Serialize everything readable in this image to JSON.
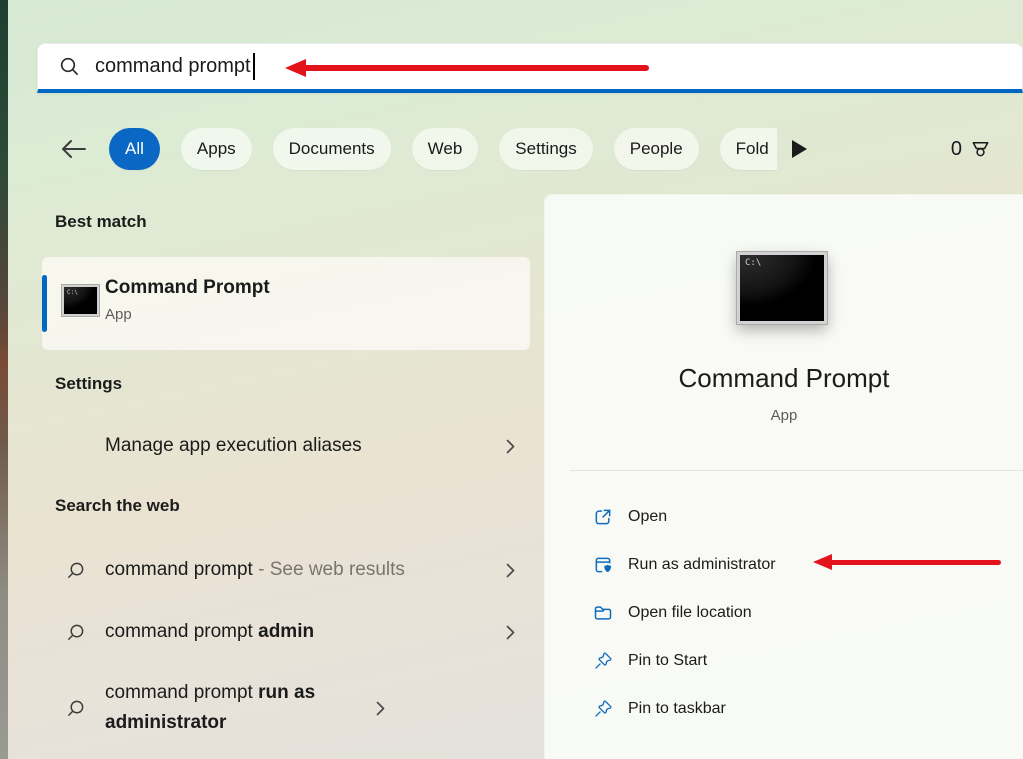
{
  "search": {
    "value": "command prompt"
  },
  "tabs": {
    "items": [
      {
        "label": "All"
      },
      {
        "label": "Apps"
      },
      {
        "label": "Documents"
      },
      {
        "label": "Web"
      },
      {
        "label": "Settings"
      },
      {
        "label": "People"
      },
      {
        "label": "Fold"
      }
    ],
    "selected": "All",
    "rewards_count": "0"
  },
  "best_match": {
    "heading": "Best match",
    "title": "Command Prompt",
    "subtitle": "App",
    "icon_label": "C:\\"
  },
  "settings_section": {
    "heading": "Settings",
    "item": "Manage app execution aliases"
  },
  "web_section": {
    "heading": "Search the web",
    "rows": [
      {
        "query": "command prompt",
        "suffix": "- See web results"
      },
      {
        "query": "command prompt",
        "bold": "admin"
      },
      {
        "query": "command prompt",
        "bold": "run as administrator"
      }
    ]
  },
  "preview": {
    "title": "Command Prompt",
    "subtitle": "App",
    "icon_label": "C:\\",
    "actions": [
      {
        "label": "Open"
      },
      {
        "label": "Run as administrator"
      },
      {
        "label": "Open file location"
      },
      {
        "label": "Pin to Start"
      },
      {
        "label": "Pin to taskbar"
      }
    ]
  },
  "colors": {
    "accent": "#0067c0",
    "selected_tab": "#0b67c4",
    "annotation_red": "#e3131b"
  }
}
